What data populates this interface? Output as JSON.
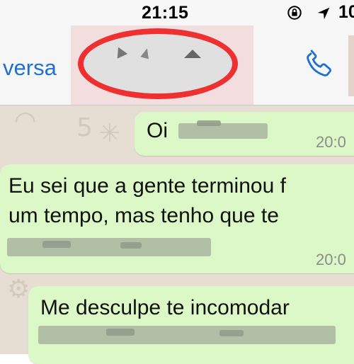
{
  "status_bar": {
    "time": "21:15",
    "battery_text": "10",
    "icons": [
      "rotation-lock-icon",
      "location-arrow-icon"
    ]
  },
  "nav_bar": {
    "back_label": "versa",
    "contact_name_redacted": true,
    "call_icon": "phone-icon"
  },
  "messages": [
    {
      "direction": "outgoing",
      "lines": [
        "Oi"
      ],
      "time": "20:0"
    },
    {
      "direction": "outgoing",
      "lines": [
        "Eu sei que a gente terminou f",
        "um tempo, mas tenho que te"
      ],
      "time": "20:0"
    },
    {
      "direction": "outgoing",
      "lines": [
        "Me desculpe te incomodar"
      ],
      "time": ""
    }
  ],
  "colors": {
    "accent_blue": "#1f6fd1",
    "bubble_green": "#dcf8c6",
    "redaction_red": "#ee3030",
    "chat_background": "#e6ddd3"
  }
}
